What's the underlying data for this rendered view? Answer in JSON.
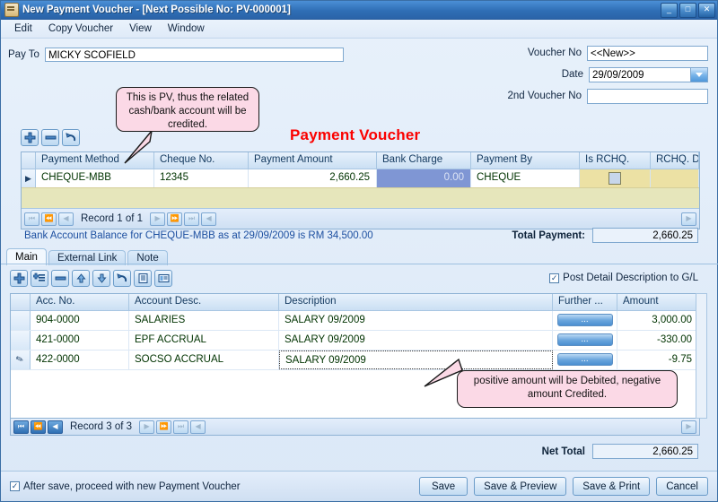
{
  "window": {
    "title": "New Payment Voucher - [Next Possible No: PV-000001]",
    "minimize": "_",
    "maximize": "□",
    "close": "✕"
  },
  "menu": [
    "Edit",
    "Copy Voucher",
    "View",
    "Window"
  ],
  "header": {
    "pay_to_label": "Pay To",
    "pay_to_value": "MICKY SCOFIELD",
    "voucher_no_label": "Voucher No",
    "voucher_no_value": "<<New>>",
    "date_label": "Date",
    "date_value": "29/09/2009",
    "second_voucher_no_label": "2nd Voucher No",
    "second_voucher_no_value": ""
  },
  "callouts": {
    "top": "This is PV, thus the related cash/bank account will be credited.",
    "bottom": "positive amount will be Debited, negative amount Credited."
  },
  "page_title": "Payment Voucher",
  "payment_toolbar": [
    {
      "name": "add-payment-button",
      "glyph": "+"
    },
    {
      "name": "remove-payment-button",
      "glyph": "−"
    },
    {
      "name": "undo-payment-button",
      "glyph": "↺"
    }
  ],
  "payment_grid": {
    "columns": [
      "Payment Method",
      "Cheque No.",
      "Payment Amount",
      "Bank Charge",
      "Payment By",
      "Is RCHQ.",
      "RCHQ. Date"
    ],
    "rows": [
      {
        "indicator": "▶",
        "payment_method": "CHEQUE-MBB",
        "cheque_no": "12345",
        "payment_amount": "2,660.25",
        "bank_charge": "0.00",
        "payment_by": "CHEQUE",
        "is_rchq": "",
        "rchq_date": ""
      }
    ],
    "navigator": {
      "label": "Record 1 of 1",
      "buttons": [
        "|◀◀",
        "◀◀",
        "◀",
        "▶",
        "▶▶",
        "▶▶|",
        "◀"
      ]
    }
  },
  "bank_balance_text": "Bank Account Balance for CHEQUE-MBB as at 29/09/2009 is RM 34,500.00",
  "total_payment": {
    "label": "Total Payment:",
    "value": "2,660.25"
  },
  "tabs": [
    {
      "label": "Main",
      "active": true
    },
    {
      "label": "External Link",
      "active": false
    },
    {
      "label": "Note",
      "active": false
    }
  ],
  "detail_toolbar": [
    {
      "name": "add-row-button",
      "glyph": "+"
    },
    {
      "name": "insert-row-button",
      "glyph": "+≡"
    },
    {
      "name": "delete-row-button",
      "glyph": "−"
    },
    {
      "name": "move-up-button",
      "glyph": "▲"
    },
    {
      "name": "move-down-button",
      "glyph": "▼"
    },
    {
      "name": "undo-row-button",
      "glyph": "↺"
    },
    {
      "name": "list-view-button",
      "glyph": "≣"
    },
    {
      "name": "detail-view-button",
      "glyph": "▤"
    }
  ],
  "post_detail_checkbox": {
    "label": "Post Detail Description to G/L",
    "checked": true,
    "mark": "✓"
  },
  "detail_grid": {
    "columns": [
      "Acc. No.",
      "Account Desc.",
      "Description",
      "Further ...",
      "Amount"
    ],
    "rows": [
      {
        "indicator": "",
        "acc_no": "904-0000",
        "account_desc": "SALARIES",
        "description": "SALARY 09/2009",
        "further": "...",
        "amount": "3,000.00"
      },
      {
        "indicator": "",
        "acc_no": "421-0000",
        "account_desc": "EPF ACCRUAL",
        "description": "SALARY 09/2009",
        "further": "...",
        "amount": "-330.00"
      },
      {
        "indicator": "✎",
        "acc_no": "422-0000",
        "account_desc": "SOCSO ACCRUAL",
        "description": "SALARY 09/2009",
        "further": "...",
        "amount": "-9.75"
      }
    ],
    "navigator": {
      "label": "Record 3 of 3"
    }
  },
  "net_total": {
    "label": "Net Total",
    "value": "2,660.25"
  },
  "footer": {
    "checkbox": {
      "label": "After save, proceed with new Payment Voucher",
      "checked": true,
      "mark": "✓"
    },
    "buttons": [
      {
        "name": "save-button",
        "label": "Save"
      },
      {
        "name": "save-preview-button",
        "label": "Save & Preview"
      },
      {
        "name": "save-print-button",
        "label": "Save & Print"
      },
      {
        "name": "cancel-button",
        "label": "Cancel"
      }
    ]
  },
  "colors": {
    "accent": "#2f6eb5",
    "title_red": "#fb0100",
    "callout_bg": "#fbd9e6",
    "selected_cell": "#7f96d4",
    "yellow_cell": "#ece1a4"
  }
}
